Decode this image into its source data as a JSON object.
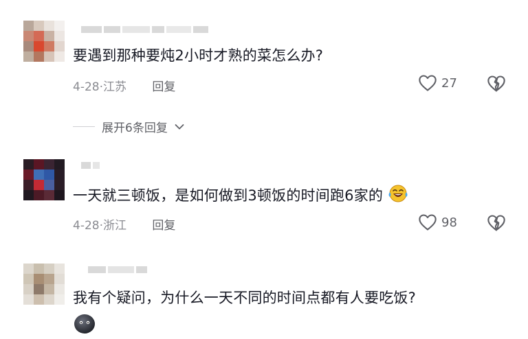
{
  "comments": [
    {
      "text": "要遇到那种要炖2小时才熟的菜怎么办?",
      "date": "4-28",
      "location": "江苏",
      "reply_label": "回复",
      "likes": "27",
      "replies_toggle": "展开6条回复"
    },
    {
      "text": "一天就三顿饭，是如何做到3顿饭的时间跑6家的",
      "date": "4-28",
      "location": "浙江",
      "reply_label": "回复",
      "likes": "98"
    },
    {
      "text": "我有个疑问，为什么一天不同的时间点都有人要吃饭?"
    }
  ],
  "icons": {
    "like": "heart-outline-icon",
    "dislike": "broken-heart-icon",
    "expand": "chevron-down-icon",
    "emoji_laugh": "laughing-crying-emoji-icon",
    "emoji_sticker": "dark-round-face-emoji-icon"
  },
  "colors": {
    "meta": "#8a8b91",
    "text": "#161823",
    "icon": "#5f6066"
  }
}
